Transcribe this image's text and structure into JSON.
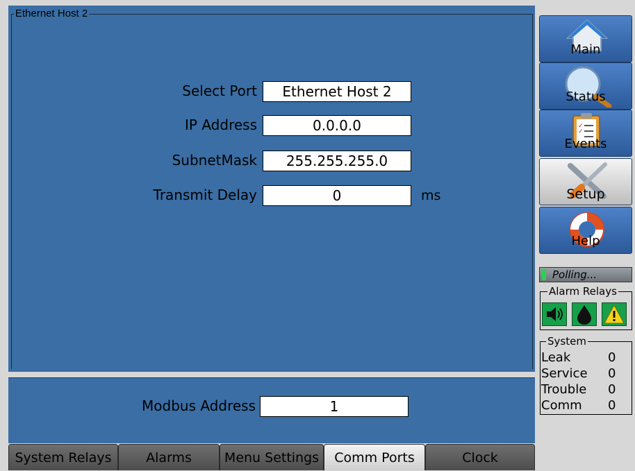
{
  "panel": {
    "title": "Ethernet Host 2"
  },
  "fields": [
    {
      "label": "Select Port",
      "value": "Ethernet Host 2"
    },
    {
      "label": "IP Address",
      "value": "0.0.0.0"
    },
    {
      "label": "SubnetMask",
      "value": "255.255.255.0"
    },
    {
      "label": "Transmit Delay",
      "value": "0",
      "unit": "ms"
    }
  ],
  "modbus": {
    "label": "Modbus Address",
    "value": "1"
  },
  "tabs": [
    {
      "label": "System Relays"
    },
    {
      "label": "Alarms"
    },
    {
      "label": "Menu Settings"
    },
    {
      "label": "Comm Ports",
      "active": true
    },
    {
      "label": "Clock"
    }
  ],
  "nav": [
    {
      "label": "Main",
      "icon": "home-icon"
    },
    {
      "label": "Status",
      "icon": "magnifier-icon"
    },
    {
      "label": "Events",
      "icon": "clipboard-icon"
    },
    {
      "label": "Setup",
      "icon": "tools-icon",
      "active": true
    },
    {
      "label": "Help",
      "icon": "lifebuoy-icon"
    }
  ],
  "status": {
    "text": "Polling..."
  },
  "alarm_relays": {
    "title": "Alarm Relays",
    "icons": [
      "speaker-icon",
      "drop-icon",
      "warning-icon"
    ]
  },
  "system": {
    "title": "System",
    "rows": [
      {
        "label": "Leak",
        "value": "0"
      },
      {
        "label": "Service",
        "value": "0"
      },
      {
        "label": "Trouble",
        "value": "0"
      },
      {
        "label": "Comm",
        "value": "0"
      }
    ]
  },
  "colors": {
    "panel": "#3a6ea5",
    "nav_blue": "#3b6fb6",
    "relay_green": "#16a04a",
    "warning_yellow": "#f2d41a"
  }
}
